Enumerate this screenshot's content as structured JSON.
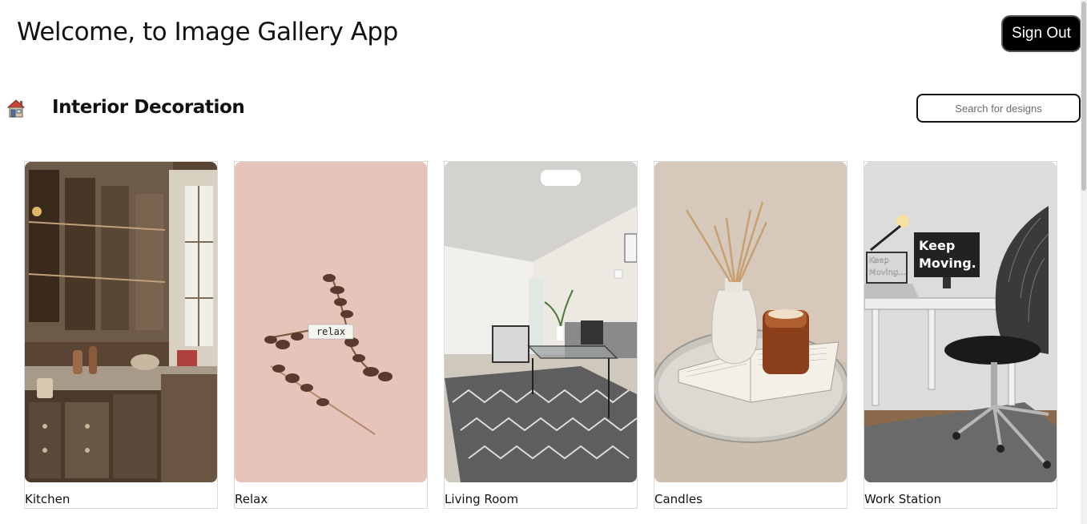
{
  "header": {
    "title": "Welcome, to Image Gallery App",
    "signout_label": "Sign Out"
  },
  "section": {
    "icon": "house-icon",
    "title": "Interior Decoration"
  },
  "search": {
    "placeholder": "Search for designs",
    "value": ""
  },
  "gallery": {
    "items": [
      {
        "label": "Kitchen"
      },
      {
        "label": "Relax",
        "photo_text": "relax"
      },
      {
        "label": "Living Room"
      },
      {
        "label": "Candles"
      },
      {
        "label": "Work Station",
        "photo_text_main": [
          "Keep",
          "Moving."
        ],
        "photo_text_small": [
          "Keep",
          "Moving..."
        ]
      }
    ]
  },
  "colors": {
    "button_bg": "#000000",
    "button_text": "#ffffff",
    "page_bg": "#ffffff"
  }
}
